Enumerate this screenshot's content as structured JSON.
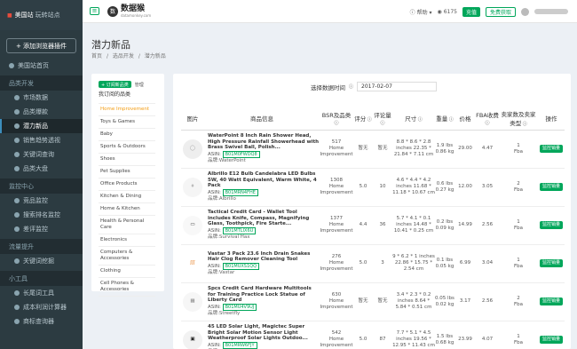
{
  "sidebar": {
    "site_flag": "■",
    "site_name": "美国站",
    "site_suffix": "玩转站点",
    "add_plugin": "+ 添加浏览器插件",
    "home": "美国站首页",
    "sec_products": "品类开发",
    "market_data": "市场数据",
    "hot_products": "品类爆款",
    "new_products": "潜力新品",
    "sales_trend": "销售趋势透视",
    "keyword_query": "关键词查询",
    "big_category": "品类大盘",
    "sec_monitor": "监控中心",
    "product_monitor": "竞品监控",
    "search_rank_monitor": "搜索排名监控",
    "review_monitor": "差评监控",
    "sec_traffic": "流量提升",
    "keyword_mining": "关键词挖掘",
    "sec_tools": "小工具",
    "long_tail": "长尾词工具",
    "profit_calc": "成本利润计算器",
    "product_research": "商标查询器"
  },
  "topbar": {
    "logo_mark": "数",
    "logo_name": "数据猴",
    "logo_url": "datamonkey.com",
    "help": "帮助",
    "points": "6175",
    "recharge": "充值",
    "free_points": "免费获取"
  },
  "page": {
    "title": "潜力新品",
    "breadcrumb": [
      "首页",
      "/",
      "选品开发",
      "/",
      "潜力新品"
    ]
  },
  "categories": {
    "add_label": "+ 订阅新品类",
    "manage_label": "管理",
    "title": "我订阅的品类",
    "items": [
      "Home Improvement",
      "Toys & Games",
      "Baby",
      "Sports & Outdoors",
      "Shoes",
      "Pet Supplies",
      "Office Products",
      "Kitchen & Dining",
      "Home & Kitchen",
      "Health & Personal Care",
      "Electronics",
      "Computers & Accessories",
      "Clothing",
      "Cell Phones & Accessories"
    ]
  },
  "filter": {
    "label": "选择数据时间",
    "value": "2017-02-07"
  },
  "table": {
    "headers": [
      "图片",
      "商品信息",
      "BSR及品类",
      "评分",
      "评论量",
      "尺寸",
      "重量",
      "价格",
      "FBA收费",
      "卖家数及卖家类型",
      "操作"
    ],
    "rows": [
      {
        "title": "WaterPoint 8 Inch Rain Shower Head, High Pressure Rainfall Showerhead with Brass Swivel Ball, Polish...",
        "asin_label": "ASIN:",
        "asin": "B01M0FWDQ8",
        "brand_label": "品牌:",
        "brand": "WaterPoint",
        "bsr": "517",
        "category": "Home Improvement",
        "rating": "暂无",
        "reviews": "暂无",
        "size": "8.8 * 8.6 * 2.8 inches 22.35 * 21.84 * 7.11 cm",
        "weight": "1.9 lbs 0.86 kg",
        "price": "29.00",
        "fba": "4.47",
        "sellers": "1",
        "seller_type": "Fba",
        "action": "监控销量"
      },
      {
        "title": "Albrillo E12 Bulb Candelabra LED Bulbs 5W, 40 Watt Equivalent, Warm White, 4 Pack",
        "asin_label": "ASIN:",
        "asin": "B01MRN4FHE",
        "brand_label": "品牌:",
        "brand": "Albrillo",
        "bsr": "1308",
        "category": "Home Improvement",
        "rating": "5.0",
        "reviews": "10",
        "size": "4.6 * 4.4 * 4.2 inches 11.68 * 11.18 * 10.67 cm",
        "weight": "0.6 lbs 0.27 kg",
        "price": "12.00",
        "fba": "3.05",
        "sellers": "2",
        "seller_type": "Fba",
        "action": "监控销量"
      },
      {
        "title": "Tactical Credit Card - Wallet Tool includes Knife, Compass, Magnifying Glass, Toothpick, Fire Starte...",
        "asin_label": "ASIN:",
        "asin": "B01MTLIX6U",
        "brand_label": "品牌:",
        "brand": "Survival Hax",
        "bsr": "1377",
        "category": "Home Improvement",
        "rating": "4.4",
        "reviews": "36",
        "size": "5.7 * 4.1 * 0.1 inches 14.48 * 10.41 * 0.25 cm",
        "weight": "0.2 lbs 0.09 kg",
        "price": "14.99",
        "fba": "2.56",
        "sellers": "1",
        "seller_type": "Fba",
        "action": "监控销量"
      },
      {
        "title": "Vastar 3 Pack 23.6 Inch Drain Snakes Hair Clog Remover Cleaning Tool",
        "asin_label": "ASIN:",
        "asin": "B01MUXS1QQ",
        "brand_label": "品牌:",
        "brand": "Vastar",
        "bsr": "276",
        "category": "Home Improvement",
        "rating": "5.0",
        "reviews": "3",
        "size": "9 * 6.2 * 1 inches 22.86 * 15.75 * 2.54 cm",
        "weight": "0.1 lbs 0.05 kg",
        "price": "6.99",
        "fba": "3.04",
        "sellers": "1",
        "seller_type": "Fba",
        "action": "监控销量"
      },
      {
        "title": "Spcs Credit Card Hardware Multitools for Training Practice Lock Statue of Liberty Card",
        "asin_label": "ASIN:",
        "asin": "B01MU4V9UJ",
        "brand_label": "品牌:",
        "brand": "Streetfly",
        "bsr": "630",
        "category": "Home Improvement",
        "rating": "暂无",
        "reviews": "暂无",
        "size": "3.4 * 2.3 * 0.2 inches 8.64 * 5.84 * 0.51 cm",
        "weight": "0.05 lbs 0.02 kg",
        "price": "3.17",
        "fba": "2.56",
        "sellers": "2",
        "seller_type": "Fba",
        "action": "监控销量"
      },
      {
        "title": "45 LED Solar Light, Magictec Super Bright Solar Motion Sensor Light Weatherproof Solar Lights Outdoo...",
        "asin_label": "ASIN:",
        "asin": "B01MRW6FJY",
        "brand_label": "品牌:",
        "brand": "Magictec",
        "bsr": "542",
        "category": "Home Improvement",
        "rating": "5.0",
        "reviews": "87",
        "size": "7.7 * 5.1 * 4.5 inches 19.56 * 12.95 * 11.43 cm",
        "weight": "1.5 lbs 0.68 kg",
        "price": "23.99",
        "fba": "4.07",
        "sellers": "1",
        "seller_type": "Fba",
        "action": "监控销量"
      }
    ]
  }
}
